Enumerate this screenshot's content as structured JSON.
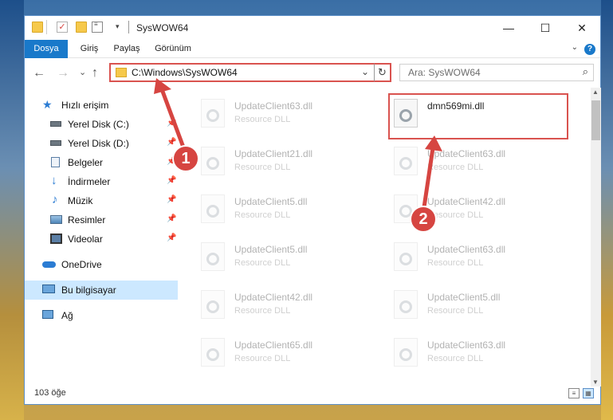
{
  "window": {
    "title": "SysWOW64",
    "minimize": "—",
    "maximize": "☐",
    "close": "✕"
  },
  "ribbon": {
    "tabs": [
      "Dosya",
      "Giriş",
      "Paylaş",
      "Görünüm"
    ],
    "active_tab": "Dosya",
    "help": "?"
  },
  "navigation": {
    "back": "←",
    "forward": "→",
    "recent": "⌄",
    "up": "↑",
    "address": "C:\\Windows\\SysWOW64",
    "refresh": "↻",
    "search_placeholder": "Ara: SysWOW64"
  },
  "sidebar": {
    "items": [
      {
        "label": "Hızlı erişim",
        "icon": "star-icon",
        "pinned": false
      },
      {
        "label": "Yerel Disk (C:)",
        "icon": "drive-icon",
        "pinned": true
      },
      {
        "label": "Yerel Disk (D:)",
        "icon": "drive-icon",
        "pinned": true
      },
      {
        "label": "Belgeler",
        "icon": "documents-icon",
        "pinned": true
      },
      {
        "label": "İndirmeler",
        "icon": "download-icon",
        "pinned": true
      },
      {
        "label": "Müzik",
        "icon": "music-icon",
        "pinned": true
      },
      {
        "label": "Resimler",
        "icon": "pictures-icon",
        "pinned": true
      },
      {
        "label": "Videolar",
        "icon": "video-icon",
        "pinned": true
      },
      {
        "label": "OneDrive",
        "icon": "cloud-icon",
        "pinned": false
      },
      {
        "label": "Bu bilgisayar",
        "icon": "computer-icon",
        "pinned": false,
        "selected": true
      },
      {
        "label": "Ağ",
        "icon": "network-icon",
        "pinned": false
      }
    ]
  },
  "files": {
    "left_column": [
      {
        "name": "UpdateClient63.dll",
        "type": "Resource DLL"
      },
      {
        "name": "UpdateClient21.dll",
        "type": "Resource DLL"
      },
      {
        "name": "UpdateClient5.dll",
        "type": "Resource DLL"
      },
      {
        "name": "UpdateClient5.dll",
        "type": "Resource DLL"
      },
      {
        "name": "UpdateClient42.dll",
        "type": "Resource DLL"
      },
      {
        "name": "UpdateClient65.dll",
        "type": "Resource DLL"
      }
    ],
    "right_column": [
      {
        "name": "dmn569mi.dll",
        "type": "",
        "highlighted": true
      },
      {
        "name": "UpdateClient63.dll",
        "type": "Resource DLL"
      },
      {
        "name": "UpdateClient42.dll",
        "type": "Resource DLL"
      },
      {
        "name": "UpdateClient63.dll",
        "type": "Resource DLL"
      },
      {
        "name": "UpdateClient5.dll",
        "type": "Resource DLL"
      },
      {
        "name": "UpdateClient63.dll",
        "type": "Resource DLL"
      }
    ]
  },
  "status": {
    "item_count": "103 öğe"
  },
  "annotations": {
    "step1": "1",
    "step2": "2",
    "color": "#d64541"
  }
}
